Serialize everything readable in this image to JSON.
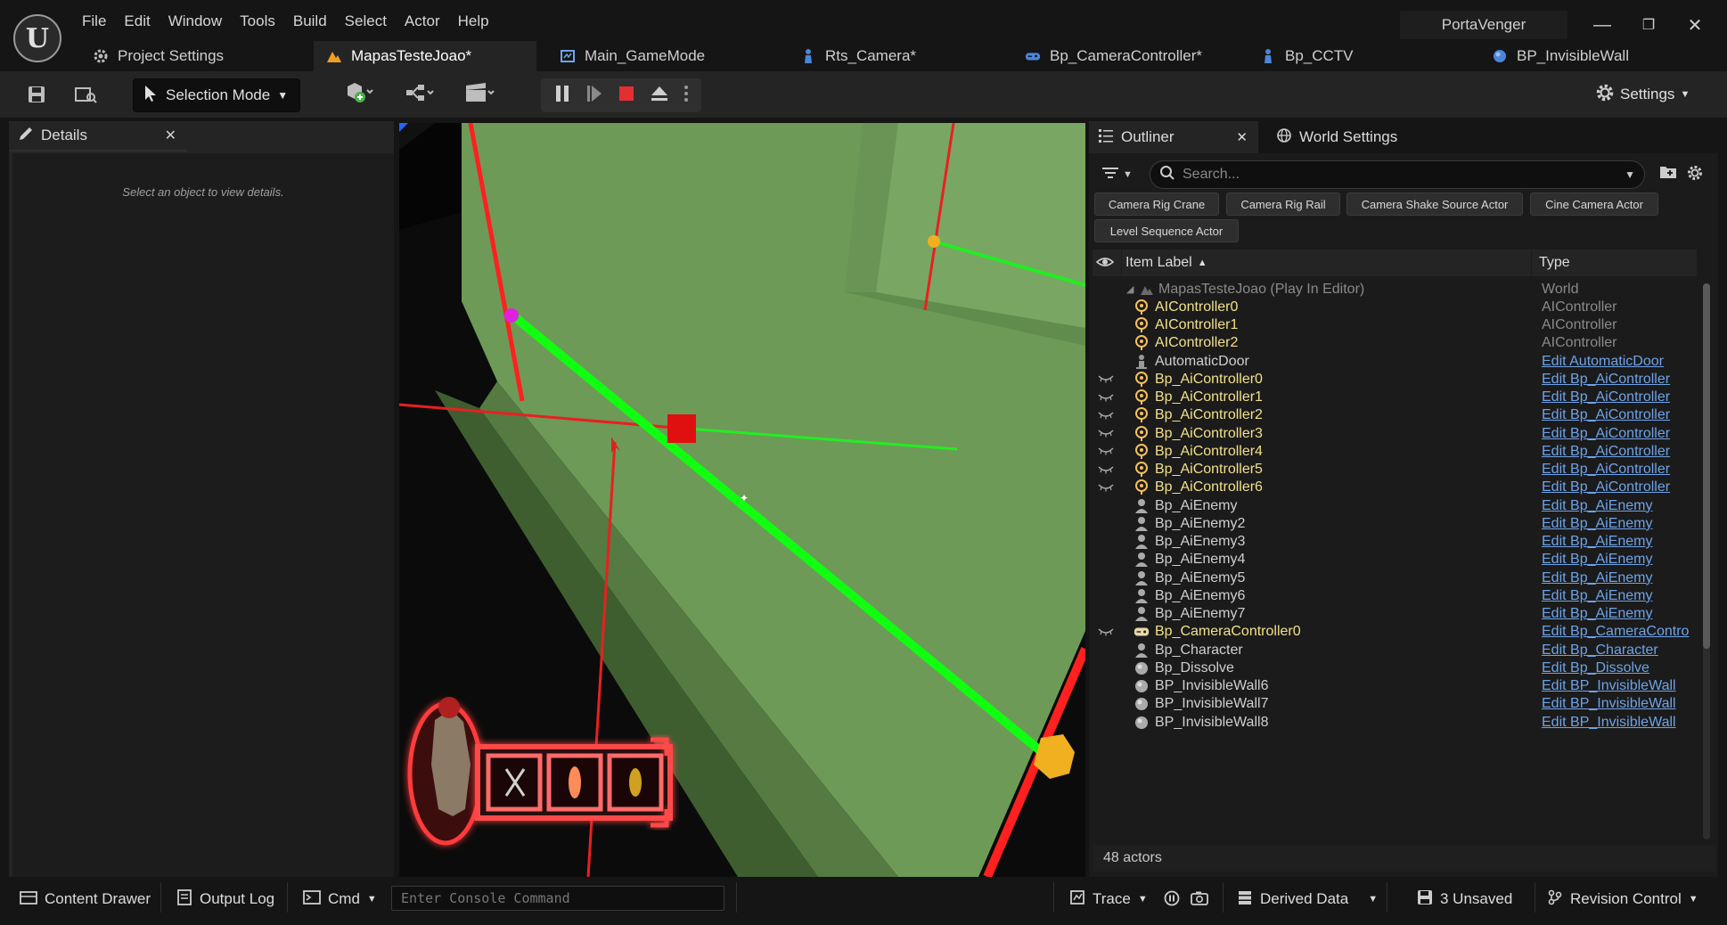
{
  "window": {
    "project_name": "PortaVenger",
    "minimize_glyph": "—",
    "restore_glyph": "❐",
    "close_glyph": "✕"
  },
  "menu": [
    "File",
    "Edit",
    "Window",
    "Tools",
    "Build",
    "Select",
    "Actor",
    "Help"
  ],
  "tabs": [
    {
      "label": "Project Settings",
      "icon": "settings-cog-icon"
    },
    {
      "label": "MapasTesteJoao*",
      "icon": "level-icon"
    },
    {
      "label": "Main_GameMode",
      "icon": "blueprint-icon"
    },
    {
      "label": "Rts_Camera*",
      "icon": "pawn-icon"
    },
    {
      "label": "Bp_CameraController*",
      "icon": "gamepad-icon"
    },
    {
      "label": "Bp_CCTV",
      "icon": "pawn-icon"
    },
    {
      "label": "BP_InvisibleWall",
      "icon": "actor-icon"
    }
  ],
  "toolbar": {
    "selection_mode": "Selection Mode",
    "settings": "Settings"
  },
  "details": {
    "tab_label": "Details",
    "empty_text": "Select an object to view details."
  },
  "outliner": {
    "tab_label": "Outliner",
    "world_settings_label": "World Settings",
    "search_placeholder": "Search...",
    "filters": [
      "Camera Rig Crane",
      "Camera Rig Rail",
      "Camera Shake Source Actor",
      "Cine Camera Actor",
      "Level Sequence Actor"
    ],
    "col_item_label": "Item Label",
    "col_type": "Type",
    "rows": [
      {
        "label": "MapasTesteJoao (Play In Editor)",
        "type": "World",
        "kind": "world",
        "eye": false
      },
      {
        "label": "AIController0",
        "type": "AIController",
        "kind": "controller",
        "eye": false
      },
      {
        "label": "AIController1",
        "type": "AIController",
        "kind": "controller",
        "eye": false
      },
      {
        "label": "AIController2",
        "type": "AIController",
        "kind": "controller",
        "eye": false
      },
      {
        "label": "AutomaticDoor",
        "type": "Edit AutomaticDoor",
        "kind": "actor",
        "eye": false
      },
      {
        "label": "Bp_AiController0",
        "type": "Edit Bp_AiController",
        "kind": "controller",
        "eye": true
      },
      {
        "label": "Bp_AiController1",
        "type": "Edit Bp_AiController",
        "kind": "controller",
        "eye": true
      },
      {
        "label": "Bp_AiController2",
        "type": "Edit Bp_AiController",
        "kind": "controller",
        "eye": true
      },
      {
        "label": "Bp_AiController3",
        "type": "Edit Bp_AiController",
        "kind": "controller",
        "eye": true
      },
      {
        "label": "Bp_AiController4",
        "type": "Edit Bp_AiController",
        "kind": "controller",
        "eye": true
      },
      {
        "label": "Bp_AiController5",
        "type": "Edit Bp_AiController",
        "kind": "controller",
        "eye": true
      },
      {
        "label": "Bp_AiController6",
        "type": "Edit Bp_AiController",
        "kind": "controller",
        "eye": true
      },
      {
        "label": "Bp_AiEnemy",
        "type": "Edit Bp_AiEnemy",
        "kind": "character",
        "eye": false
      },
      {
        "label": "Bp_AiEnemy2",
        "type": "Edit Bp_AiEnemy",
        "kind": "character",
        "eye": false
      },
      {
        "label": "Bp_AiEnemy3",
        "type": "Edit Bp_AiEnemy",
        "kind": "character",
        "eye": false
      },
      {
        "label": "Bp_AiEnemy4",
        "type": "Edit Bp_AiEnemy",
        "kind": "character",
        "eye": false
      },
      {
        "label": "Bp_AiEnemy5",
        "type": "Edit Bp_AiEnemy",
        "kind": "character",
        "eye": false
      },
      {
        "label": "Bp_AiEnemy6",
        "type": "Edit Bp_AiEnemy",
        "kind": "character",
        "eye": false
      },
      {
        "label": "Bp_AiEnemy7",
        "type": "Edit Bp_AiEnemy",
        "kind": "character",
        "eye": false
      },
      {
        "label": "Bp_CameraController0",
        "type": "Edit Bp_CameraContro",
        "kind": "gamepad",
        "eye": true
      },
      {
        "label": "Bp_Character",
        "type": "Edit Bp_Character",
        "kind": "character",
        "eye": false
      },
      {
        "label": "Bp_Dissolve",
        "type": "Edit Bp_Dissolve",
        "kind": "sphere",
        "eye": false
      },
      {
        "label": "BP_InvisibleWall6",
        "type": "Edit BP_InvisibleWall",
        "kind": "sphere",
        "eye": false
      },
      {
        "label": "BP_InvisibleWall7",
        "type": "Edit BP_InvisibleWall",
        "kind": "sphere",
        "eye": false
      },
      {
        "label": "BP_InvisibleWall8",
        "type": "Edit BP_InvisibleWall",
        "kind": "sphere",
        "eye": false
      }
    ],
    "actor_count": "48 actors"
  },
  "bottom": {
    "content_drawer": "Content Drawer",
    "output_log": "Output Log",
    "cmd": "Cmd",
    "console_placeholder": "Enter Console Command",
    "trace": "Trace",
    "derived_data": "Derived Data",
    "unsaved": "3 Unsaved",
    "revision_control": "Revision Control"
  },
  "colors": {
    "accent_orange": "#f0a020",
    "controller_yellow": "#f2e08a",
    "link_blue": "#6fa3e8",
    "stop_red": "#e23030",
    "floor_green": "#6e9a57"
  }
}
